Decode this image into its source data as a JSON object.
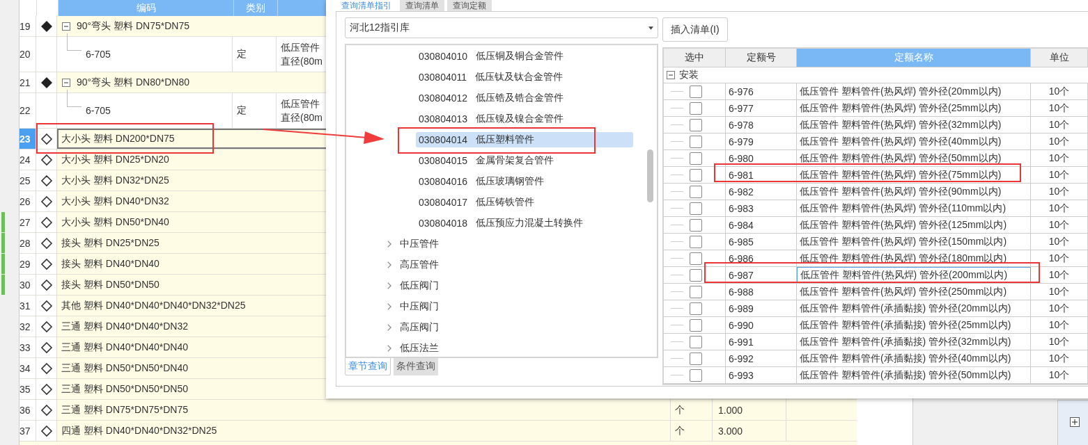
{
  "grid": {
    "columns": [
      {
        "label": "编码"
      },
      {
        "label": "类别"
      }
    ],
    "rows": [
      {
        "kind": "item",
        "number": "19",
        "filled": true,
        "expanded": true,
        "selected": false,
        "modified": false,
        "text": "90°弯头 塑料 DN75*DN75"
      },
      {
        "kind": "sub",
        "number": "20",
        "selected": false,
        "modified": false,
        "code": "6-705",
        "type": "定",
        "desc": [
          "低压管件",
          "直径(80m"
        ]
      },
      {
        "kind": "item",
        "number": "21",
        "filled": true,
        "expanded": true,
        "selected": false,
        "modified": false,
        "text": "90°弯头 塑料 DN80*DN80"
      },
      {
        "kind": "sub",
        "number": "22",
        "selected": false,
        "modified": false,
        "code": "6-705",
        "type": "定",
        "desc": [
          "低压管件",
          "直径(80m"
        ]
      },
      {
        "kind": "item",
        "number": "23",
        "filled": false,
        "selected": true,
        "modified": false,
        "text": "大小头 塑料 DN200*DN75"
      },
      {
        "kind": "item",
        "number": "24",
        "filled": false,
        "selected": false,
        "modified": false,
        "text": "大小头 塑料 DN25*DN20"
      },
      {
        "kind": "item",
        "number": "25",
        "filled": false,
        "selected": false,
        "modified": false,
        "text": "大小头 塑料 DN32*DN25"
      },
      {
        "kind": "item",
        "number": "26",
        "filled": false,
        "selected": false,
        "modified": false,
        "text": "大小头 塑料 DN40*DN32"
      },
      {
        "kind": "item",
        "number": "27",
        "filled": false,
        "selected": false,
        "modified": true,
        "text": "大小头 塑料 DN50*DN40"
      },
      {
        "kind": "item",
        "number": "28",
        "filled": false,
        "selected": false,
        "modified": true,
        "text": "接头 塑料 DN25*DN25"
      },
      {
        "kind": "item",
        "number": "29",
        "filled": false,
        "selected": false,
        "modified": true,
        "text": "接头 塑料 DN40*DN40"
      },
      {
        "kind": "item",
        "number": "30",
        "filled": false,
        "selected": false,
        "modified": true,
        "text": "接头 塑料 DN50*DN50"
      },
      {
        "kind": "item",
        "number": "31",
        "filled": false,
        "selected": false,
        "modified": false,
        "text": "其他 塑料 DN40*DN40*DN40*DN32*DN25"
      },
      {
        "kind": "item",
        "number": "32",
        "filled": false,
        "selected": false,
        "modified": false,
        "text": "三通 塑料 DN40*DN40*DN32"
      },
      {
        "kind": "item",
        "number": "33",
        "filled": false,
        "selected": false,
        "modified": false,
        "text": "三通 塑料 DN40*DN40*DN40"
      },
      {
        "kind": "item",
        "number": "34",
        "filled": false,
        "selected": false,
        "modified": false,
        "text": "三通 塑料 DN50*DN50*DN40"
      },
      {
        "kind": "item",
        "number": "35",
        "filled": false,
        "selected": false,
        "modified": false,
        "text": "三通 塑料 DN50*DN50*DN50"
      },
      {
        "kind": "item",
        "number": "36",
        "filled": false,
        "selected": false,
        "modified": false,
        "text": "三通 塑料 DN75*DN75*DN75",
        "unit": "个",
        "quantity": "1.000"
      },
      {
        "kind": "item",
        "number": "37",
        "filled": false,
        "selected": false,
        "modified": false,
        "text": "四通 塑料 DN40*DN40*DN32*DN25",
        "unit": "个",
        "quantity": "3.000"
      }
    ]
  },
  "dialog": {
    "tabs": [
      {
        "label": "查询清单指引",
        "selected": true
      },
      {
        "label": "查询清单",
        "selected": false
      },
      {
        "label": "查询定额",
        "selected": false
      }
    ],
    "library": {
      "value": "河北12指引库"
    },
    "tree": [
      {
        "kind": "leaf",
        "code": "030804010",
        "name": "低压铜及铜合金管件",
        "selected": false
      },
      {
        "kind": "leaf",
        "code": "030804011",
        "name": "低压钛及钛合金管件",
        "selected": false
      },
      {
        "kind": "leaf",
        "code": "030804012",
        "name": "低压锆及锆合金管件",
        "selected": false
      },
      {
        "kind": "leaf",
        "code": "030804013",
        "name": "低压镍及镍合金管件",
        "selected": false
      },
      {
        "kind": "leaf",
        "code": "030804014",
        "name": "低压塑料管件",
        "selected": true
      },
      {
        "kind": "leaf",
        "code": "030804015",
        "name": "金属骨架复合管件",
        "selected": false
      },
      {
        "kind": "leaf",
        "code": "030804016",
        "name": "低压玻璃钢管件",
        "selected": false
      },
      {
        "kind": "leaf",
        "code": "030804017",
        "name": "低压铸铁管件",
        "selected": false
      },
      {
        "kind": "leaf",
        "code": "030804018",
        "name": "低压预应力混凝土转换件",
        "selected": false
      },
      {
        "kind": "group",
        "label": "中压管件",
        "expanded": false
      },
      {
        "kind": "group",
        "label": "高压管件",
        "expanded": false
      },
      {
        "kind": "group",
        "label": "低压阀门",
        "expanded": false
      },
      {
        "kind": "group",
        "label": "中压阀门",
        "expanded": false
      },
      {
        "kind": "group",
        "label": "高压阀门",
        "expanded": false
      },
      {
        "kind": "group",
        "label": "低压法兰",
        "expanded": false
      }
    ],
    "bottom_tabs": [
      {
        "label": "章节查询",
        "selected": true
      },
      {
        "label": "条件查询",
        "selected": false
      }
    ],
    "insert_button": "插入清单(I)",
    "quota_table": {
      "columns": [
        {
          "label": "选中",
          "selected": false
        },
        {
          "label": "定额号",
          "selected": false
        },
        {
          "label": "定额名称",
          "selected": true
        },
        {
          "label": "单位",
          "selected": false
        }
      ],
      "group": {
        "label": "安装",
        "expanded": true
      },
      "rows": [
        {
          "code": "6-976",
          "name": "低压管件 塑料管件(热风焊) 管外径(20mm以内)",
          "unit": "10个",
          "checked": false,
          "focused": false
        },
        {
          "code": "6-977",
          "name": "低压管件 塑料管件(热风焊) 管外径(25mm以内)",
          "unit": "10个",
          "checked": false,
          "focused": false
        },
        {
          "code": "6-978",
          "name": "低压管件 塑料管件(热风焊) 管外径(32mm以内)",
          "unit": "10个",
          "checked": false,
          "focused": false
        },
        {
          "code": "6-979",
          "name": "低压管件 塑料管件(热风焊) 管外径(40mm以内)",
          "unit": "10个",
          "checked": false,
          "focused": false
        },
        {
          "code": "6-980",
          "name": "低压管件 塑料管件(热风焊) 管外径(50mm以内)",
          "unit": "10个",
          "checked": false,
          "focused": false
        },
        {
          "code": "6-981",
          "name": "低压管件 塑料管件(热风焊) 管外径(75mm以内)",
          "unit": "10个",
          "checked": false,
          "focused": false
        },
        {
          "code": "6-982",
          "name": "低压管件 塑料管件(热风焊) 管外径(90mm以内)",
          "unit": "10个",
          "checked": false,
          "focused": false
        },
        {
          "code": "6-983",
          "name": "低压管件 塑料管件(热风焊) 管外径(110mm以内)",
          "unit": "10个",
          "checked": false,
          "focused": false
        },
        {
          "code": "6-984",
          "name": "低压管件 塑料管件(热风焊) 管外径(125mm以内)",
          "unit": "10个",
          "checked": false,
          "focused": false
        },
        {
          "code": "6-985",
          "name": "低压管件 塑料管件(热风焊) 管外径(150mm以内)",
          "unit": "10个",
          "checked": false,
          "focused": false
        },
        {
          "code": "6-986",
          "name": "低压管件 塑料管件(热风焊) 管外径(180mm以内)",
          "unit": "10个",
          "checked": false,
          "focused": false
        },
        {
          "code": "6-987",
          "name": "低压管件 塑料管件(热风焊) 管外径(200mm以内)",
          "unit": "10个",
          "checked": false,
          "focused": true
        },
        {
          "code": "6-988",
          "name": "低压管件 塑料管件(热风焊) 管外径(250mm以内)",
          "unit": "10个",
          "checked": false,
          "focused": false
        },
        {
          "code": "6-989",
          "name": "低压管件 塑料管件(承插黏接) 管外径(20mm以内)",
          "unit": "10个",
          "checked": false,
          "focused": false
        },
        {
          "code": "6-990",
          "name": "低压管件 塑料管件(承插黏接) 管外径(25mm以内)",
          "unit": "10个",
          "checked": false,
          "focused": false
        },
        {
          "code": "6-991",
          "name": "低压管件 塑料管件(承插黏接) 管外径(32mm以内)",
          "unit": "10个",
          "checked": false,
          "focused": false
        },
        {
          "code": "6-992",
          "name": "低压管件 塑料管件(承插黏接) 管外径(40mm以内)",
          "unit": "10个",
          "checked": false,
          "focused": false
        },
        {
          "code": "6-993",
          "name": "低压管件 塑料管件(承插黏接) 管外径(50mm以内)",
          "unit": "10个",
          "checked": false,
          "focused": false
        }
      ]
    }
  }
}
